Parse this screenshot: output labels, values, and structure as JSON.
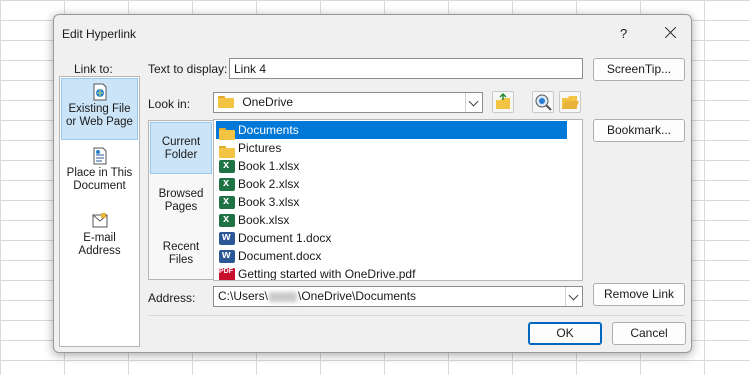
{
  "dialog": {
    "title": "Edit Hyperlink",
    "help_label": "?"
  },
  "link_to": {
    "label": "Link to:",
    "items": [
      {
        "line1": "Existing File",
        "line2": "or Web Page",
        "icon": "existing-file-icon",
        "selected": true
      },
      {
        "line1": "Place in This",
        "line2": "Document",
        "icon": "place-in-document-icon",
        "selected": false
      },
      {
        "line1": "E-mail",
        "line2": "Address",
        "icon": "email-address-icon",
        "selected": false
      }
    ]
  },
  "text_to_display": {
    "label": "Text to display:",
    "value": "Link 4"
  },
  "screentip_button": "ScreenTip...",
  "look_in": {
    "label": "Look in:",
    "value": "OneDrive"
  },
  "browse": {
    "items": [
      {
        "line1": "Current",
        "line2": "Folder",
        "selected": true
      },
      {
        "line1": "Browsed",
        "line2": "Pages",
        "selected": false
      },
      {
        "line1": "Recent",
        "line2": "Files",
        "selected": false
      }
    ]
  },
  "files": [
    {
      "name": "Documents",
      "type": "folder",
      "selected": true
    },
    {
      "name": "Pictures",
      "type": "folder",
      "selected": false
    },
    {
      "name": "Book 1.xlsx",
      "type": "excel",
      "selected": false
    },
    {
      "name": "Book 2.xlsx",
      "type": "excel",
      "selected": false
    },
    {
      "name": "Book 3.xlsx",
      "type": "excel",
      "selected": false
    },
    {
      "name": "Book.xlsx",
      "type": "excel",
      "selected": false
    },
    {
      "name": "Document 1.docx",
      "type": "word",
      "selected": false
    },
    {
      "name": "Document.docx",
      "type": "word",
      "selected": false
    },
    {
      "name": "Getting started with OneDrive.pdf",
      "type": "pdf",
      "selected": false
    }
  ],
  "bookmark_button": "Bookmark...",
  "address": {
    "label": "Address:",
    "prefix": "C:\\Users\\",
    "suffix": "\\OneDrive\\Documents"
  },
  "remove_link_button": "Remove Link",
  "ok_button": "OK",
  "cancel_button": "Cancel",
  "colors": {
    "selection": "#0078d7",
    "selected_panel": "#cce4f7",
    "folder": "#f3c343",
    "excel": "#1f7244",
    "word": "#2b5797",
    "pdf": "#c8102e"
  }
}
